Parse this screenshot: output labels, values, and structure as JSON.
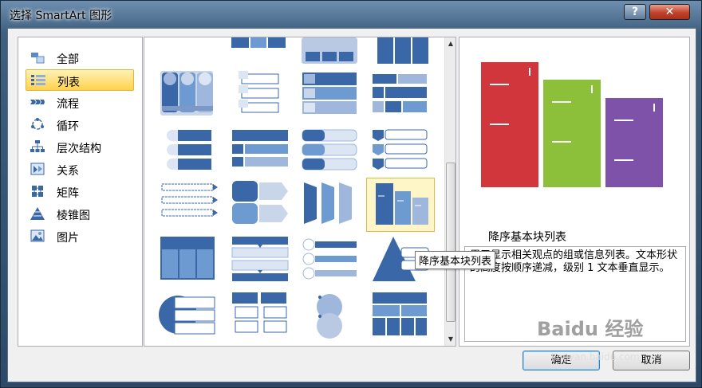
{
  "window": {
    "title": "选择 SmartArt 图形",
    "help_label": "?",
    "close_label": "✕"
  },
  "categories": [
    {
      "label": "全部",
      "icon": "all-icon"
    },
    {
      "label": "列表",
      "icon": "list-icon",
      "selected": true
    },
    {
      "label": "流程",
      "icon": "process-icon"
    },
    {
      "label": "循环",
      "icon": "cycle-icon"
    },
    {
      "label": "层次结构",
      "icon": "hierarchy-icon"
    },
    {
      "label": "关系",
      "icon": "relationship-icon"
    },
    {
      "label": "矩阵",
      "icon": "matrix-icon"
    },
    {
      "label": "棱锥图",
      "icon": "pyramid-icon"
    },
    {
      "label": "图片",
      "icon": "picture-icon"
    }
  ],
  "gallery": {
    "selected_item": "降序基本块列表",
    "tooltip": "降序基本块列表"
  },
  "preview": {
    "title": "降序基本块列表",
    "description": "用于显示相关观点的组或信息列表。文本形状的高度按顺序递减，级别 1 文本垂直显示。",
    "colors": {
      "red": "#d0363b",
      "green": "#8cbf3a",
      "purple": "#7e52a8"
    }
  },
  "buttons": {
    "ok": "确定",
    "cancel": "取消"
  },
  "watermark": {
    "text": "Baidu 经验",
    "sub": "jingyan.baidu.com"
  },
  "accent": "#3a67a8"
}
